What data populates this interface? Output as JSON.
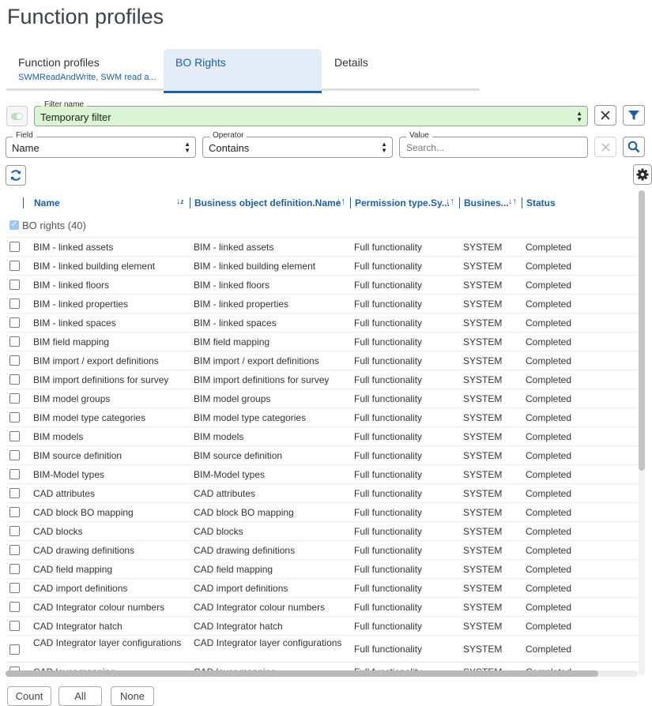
{
  "page": {
    "title": "Function profiles"
  },
  "tabs": [
    {
      "label": "Function profiles",
      "sub": "SWMReadAndWrite, SWM read a..."
    },
    {
      "label": "BO Rights",
      "sub": ""
    },
    {
      "label": "Details",
      "sub": ""
    }
  ],
  "filter": {
    "name_legend": "Filter name",
    "name_value": "Temporary filter",
    "field_legend": "Field",
    "field_value": "Name",
    "operator_legend": "Operator",
    "operator_value": "Contains",
    "value_legend": "Value",
    "value_placeholder": "Search..."
  },
  "columns": {
    "name": "Name",
    "bod": "Business object definition.Name",
    "perm": "Permission type.Sy...",
    "bus": "Busines...",
    "status": "Status"
  },
  "group": {
    "label": "BO rights (40)"
  },
  "rows": [
    {
      "name": "BIM - linked assets",
      "bod": "BIM - linked assets",
      "perm": "Full functionality",
      "bus": "SYSTEM",
      "status": "Completed"
    },
    {
      "name": "BIM - linked building element",
      "bod": "BIM - linked building element",
      "perm": "Full functionality",
      "bus": "SYSTEM",
      "status": "Completed"
    },
    {
      "name": "BIM - linked floors",
      "bod": "BIM - linked floors",
      "perm": "Full functionality",
      "bus": "SYSTEM",
      "status": "Completed"
    },
    {
      "name": "BIM - linked properties",
      "bod": "BIM - linked properties",
      "perm": "Full functionality",
      "bus": "SYSTEM",
      "status": "Completed"
    },
    {
      "name": "BIM - linked spaces",
      "bod": "BIM - linked spaces",
      "perm": "Full functionality",
      "bus": "SYSTEM",
      "status": "Completed"
    },
    {
      "name": "BIM field mapping",
      "bod": "BIM field mapping",
      "perm": "Full functionality",
      "bus": "SYSTEM",
      "status": "Completed"
    },
    {
      "name": "BIM import / export definitions",
      "bod": "BIM import / export definitions",
      "perm": "Full functionality",
      "bus": "SYSTEM",
      "status": "Completed"
    },
    {
      "name": "BIM import definitions for survey",
      "bod": "BIM import definitions for survey",
      "perm": "Full functionality",
      "bus": "SYSTEM",
      "status": "Completed"
    },
    {
      "name": "BIM model groups",
      "bod": "BIM model groups",
      "perm": "Full functionality",
      "bus": "SYSTEM",
      "status": "Completed"
    },
    {
      "name": "BIM model type categories",
      "bod": "BIM model type categories",
      "perm": "Full functionality",
      "bus": "SYSTEM",
      "status": "Completed"
    },
    {
      "name": "BIM models",
      "bod": "BIM models",
      "perm": "Full functionality",
      "bus": "SYSTEM",
      "status": "Completed"
    },
    {
      "name": "BIM source definition",
      "bod": "BIM source definition",
      "perm": "Full functionality",
      "bus": "SYSTEM",
      "status": "Completed"
    },
    {
      "name": "BIM-Model types",
      "bod": "BIM-Model types",
      "perm": "Full functionality",
      "bus": "SYSTEM",
      "status": "Completed"
    },
    {
      "name": "CAD attributes",
      "bod": "CAD attributes",
      "perm": "Full functionality",
      "bus": "SYSTEM",
      "status": "Completed"
    },
    {
      "name": "CAD block BO mapping",
      "bod": "CAD block BO mapping",
      "perm": "Full functionality",
      "bus": "SYSTEM",
      "status": "Completed"
    },
    {
      "name": "CAD blocks",
      "bod": "CAD blocks",
      "perm": "Full functionality",
      "bus": "SYSTEM",
      "status": "Completed"
    },
    {
      "name": "CAD drawing definitions",
      "bod": "CAD drawing definitions",
      "perm": "Full functionality",
      "bus": "SYSTEM",
      "status": "Completed"
    },
    {
      "name": "CAD field mapping",
      "bod": "CAD field mapping",
      "perm": "Full functionality",
      "bus": "SYSTEM",
      "status": "Completed"
    },
    {
      "name": "CAD import definitions",
      "bod": "CAD import definitions",
      "perm": "Full functionality",
      "bus": "SYSTEM",
      "status": "Completed"
    },
    {
      "name": "CAD Integrator colour numbers",
      "bod": "CAD Integrator colour numbers",
      "perm": "Full functionality",
      "bus": "SYSTEM",
      "status": "Completed"
    },
    {
      "name": "CAD Integrator hatch",
      "bod": "CAD Integrator hatch",
      "perm": "Full functionality",
      "bus": "SYSTEM",
      "status": "Completed"
    },
    {
      "name": "CAD Integrator layer configurations",
      "bod": "CAD Integrator layer configurations",
      "perm": "Full functionality",
      "bus": "SYSTEM",
      "status": "Completed"
    },
    {
      "name": "CAD layer mapping",
      "bod": "CAD layer mapping",
      "perm": "Full functionality",
      "bus": "SYSTEM",
      "status": "Completed"
    }
  ],
  "footer": {
    "count": "Count",
    "all": "All",
    "none": "None"
  }
}
